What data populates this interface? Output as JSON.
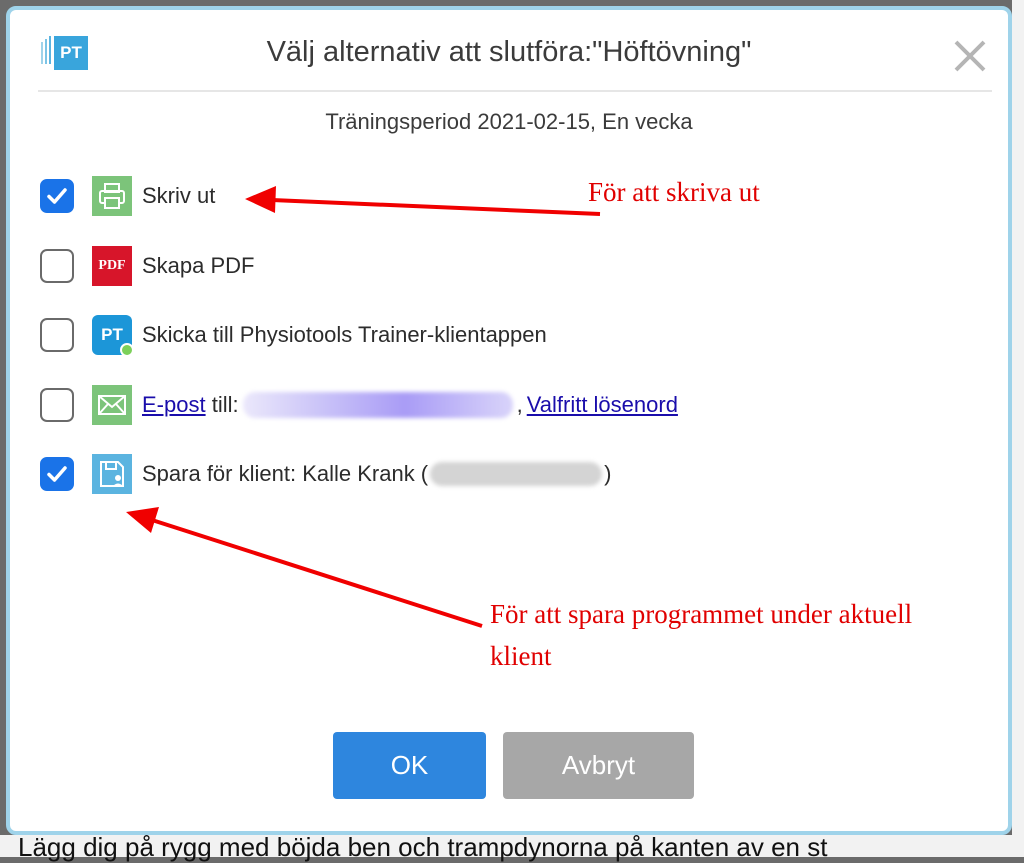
{
  "background": {
    "text": "Lägg dig på rygg med böjda ben och trampdynorna på kanten av en st"
  },
  "dialog": {
    "logo_text": "PT",
    "title": "Välj alternativ att slutföra:\"Höftövning\"",
    "subtitle": "Träningsperiod 2021-02-15, En vecka",
    "options": [
      {
        "label": "Skriv ut",
        "checked": true,
        "icon": "printer-icon"
      },
      {
        "label": "Skapa PDF",
        "checked": false,
        "icon": "pdf-icon",
        "icon_text": "PDF"
      },
      {
        "label": "Skicka till Physiotools Trainer-klientappen",
        "checked": false,
        "icon": "pt-app-icon",
        "icon_text": "PT"
      },
      {
        "link_label": "E-post",
        "mid_text": " till:",
        "sep_text": ",",
        "link2_label": "Valfritt lösenord",
        "checked": false,
        "icon": "mail-icon"
      },
      {
        "label": "Spara för klient: Kalle Krank (",
        "suffix": ")",
        "checked": true,
        "icon": "save-client-icon"
      }
    ],
    "buttons": {
      "ok": "OK",
      "cancel": "Avbryt"
    }
  },
  "annotations": {
    "print": "För att skriva ut",
    "save_line1": "För att spara programmet under aktuell",
    "save_line2": "klient"
  },
  "colors": {
    "accent": "#2e86de",
    "checkbox_checked": "#1a73e8",
    "annotation": "#e00000",
    "dialog_border": "#9fd3ea"
  }
}
